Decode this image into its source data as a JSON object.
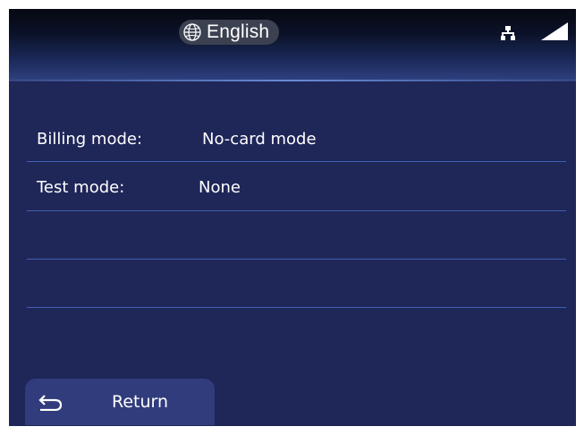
{
  "header": {
    "language_label": "English",
    "icons": [
      "globe-icon",
      "network-icon",
      "signal-icon"
    ]
  },
  "rows": [
    {
      "label": "Billing mode:",
      "value": "No-card mode"
    },
    {
      "label": "Test mode:",
      "value": "None"
    },
    {
      "label": "",
      "value": ""
    },
    {
      "label": "",
      "value": ""
    }
  ],
  "footer": {
    "return_label": "Return",
    "return_icon": "return-arrow-icon"
  },
  "colors": {
    "background": "#1f2658",
    "divider": "#3f60b4",
    "button": "#313c7c",
    "text": "#ffffff"
  }
}
